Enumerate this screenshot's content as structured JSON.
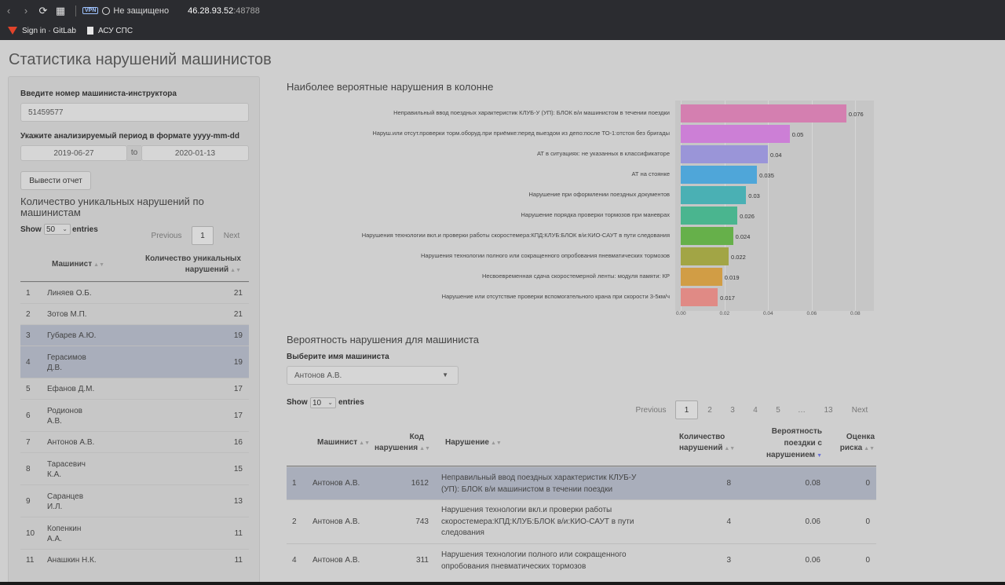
{
  "browser": {
    "vpn_badge": "VPN",
    "security_text": "Не защищено",
    "url_host": "46.28.93.52",
    "url_port": ":48788",
    "bookmarks": [
      "Sign in · GitLab",
      "АСУ СПС"
    ]
  },
  "page_title": "Статистика нарушений машинистов",
  "sidebar": {
    "instructor_label": "Введите номер машиниста-инструктора",
    "instructor_value": "51459577",
    "period_label": "Укажите анализируемый период в формате yyyy-mm-dd",
    "date_from": "2019-06-27",
    "date_to_sep": "to",
    "date_to": "2020-01-13",
    "report_button": "Вывести отчет",
    "unique_title": "Количество уникальных нарушений по машинистам",
    "show_label": "Show",
    "show_value": "50",
    "entries_label": "entries",
    "prev": "Previous",
    "page": "1",
    "next": "Next",
    "col_driver": "Машинист",
    "col_count": "Количество уникальных нарушений",
    "rows": [
      {
        "n": "1",
        "name": "Линяев О.Б.",
        "count": "21"
      },
      {
        "n": "2",
        "name": "Зотов М.П.",
        "count": "21"
      },
      {
        "n": "3",
        "name": "Губарев А.Ю.",
        "count": "19"
      },
      {
        "n": "4",
        "name": "Герасимов Д.В.",
        "count": "19"
      },
      {
        "n": "5",
        "name": "Ефанов Д.М.",
        "count": "17"
      },
      {
        "n": "6",
        "name": "Родионов А.В.",
        "count": "17"
      },
      {
        "n": "7",
        "name": "Антонов А.В.",
        "count": "16"
      },
      {
        "n": "8",
        "name": "Тарасевич К.А.",
        "count": "15"
      },
      {
        "n": "9",
        "name": "Саранцев И.Л.",
        "count": "13"
      },
      {
        "n": "10",
        "name": "Копенкин А.А.",
        "count": "11"
      },
      {
        "n": "11",
        "name": "Анашкин Н.К.",
        "count": "11"
      }
    ]
  },
  "chart_title": "Наиболее вероятные нарушения в колонне",
  "chart_data": {
    "type": "bar",
    "orientation": "horizontal",
    "categories": [
      "Неправильный ввод поездных характеристик КЛУБ-У (УП): БЛОК в/и  машинистом в течении поездки",
      "Наруш.или отсут.проверки торм.оборуд.при приёмке:перед выездом из депо:после ТО-1:отстоя без бригады",
      "АТ в ситуациях: не указанных в классификаторе",
      "АТ на стоянке",
      "Нарушение при оформлении поездных документов",
      "Нарушение порядка проверки тормозов при маневрах",
      "Нарушения технологии вкл.и проверки работы скоростемера:КПД:КЛУБ:БЛОК в/и:КИО-САУТ в пути следования",
      "Нарушения технологии полного или сокращенного опробования пневматических тормозов",
      "Несвоевременная сдача скоростемерной ленты: модуля памяти: КР",
      "Нарушение или отсутствие проверки вспомогательного крана при скорости 3-5км/ч"
    ],
    "values": [
      0.076,
      0.05,
      0.04,
      0.035,
      0.03,
      0.026,
      0.024,
      0.022,
      0.019,
      0.017
    ],
    "value_labels": [
      "0.076",
      "0.05",
      "0.04",
      "0.035",
      "0.03",
      "0.026",
      "0.024",
      "0.022",
      "0.019",
      "0.017"
    ],
    "colors": [
      "#d47fb0",
      "#cc7fd6",
      "#9a95d8",
      "#4fa6d9",
      "#4ab0b4",
      "#4ab58f",
      "#66b04a",
      "#a2a545",
      "#d19d45",
      "#e08a85"
    ],
    "xlim": [
      0,
      0.08
    ],
    "xticks": [
      "0.00",
      "0.02",
      "0.04",
      "0.06",
      "0.08"
    ],
    "xtick_values": [
      0,
      0.02,
      0.04,
      0.06,
      0.08
    ],
    "grid": true
  },
  "probability": {
    "title": "Вероятность нарушения для машиниста",
    "select_label": "Выберите имя машиниста",
    "select_value": "Антонов А.В.",
    "show_label": "Show",
    "show_value": "10",
    "entries_label": "entries",
    "prev": "Previous",
    "pages": [
      "1",
      "2",
      "3",
      "4",
      "5",
      "…",
      "13"
    ],
    "next": "Next",
    "headers": {
      "driver": "Машинист",
      "code": "Код нарушения",
      "violation": "Нарушение",
      "qty": "Количество нарушений",
      "prob": "Вероятность поездки с нарушением",
      "risk": "Оценка риска"
    },
    "rows": [
      {
        "n": "1",
        "driver": "Антонов А.В.",
        "code": "1612",
        "violation": "Неправильный ввод поездных характеристик КЛУБ-У (УП): БЛОК в/и машинистом в течении поездки",
        "qty": "8",
        "prob": "0.08",
        "risk": "0"
      },
      {
        "n": "2",
        "driver": "Антонов А.В.",
        "code": "743",
        "violation": "Нарушения технологии вкл.и проверки работы скоростемера:КПД:КЛУБ:БЛОК в/и:КИО-САУТ в пути следования",
        "qty": "4",
        "prob": "0.06",
        "risk": "0"
      },
      {
        "n": "4",
        "driver": "Антонов А.В.",
        "code": "311",
        "violation": "Нарушения технологии полного или сокращенного опробования пневматических тормозов",
        "qty": "3",
        "prob": "0.06",
        "risk": "0"
      }
    ]
  }
}
